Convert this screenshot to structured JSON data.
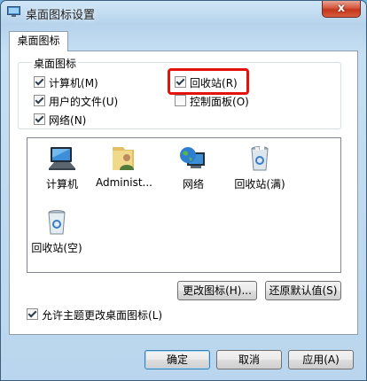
{
  "window": {
    "title": "桌面图标设置",
    "close_glyph": "x"
  },
  "tab": {
    "label": "桌面图标"
  },
  "group": {
    "title": "桌面图标",
    "items": [
      {
        "label": "计算机",
        "key": "(M)",
        "checked": true
      },
      {
        "label": "回收站",
        "key": "(R)",
        "checked": true,
        "highlighted": true
      },
      {
        "label": "用户的文件",
        "key": "(U)",
        "checked": true
      },
      {
        "label": "控制面板",
        "key": "(O)",
        "checked": false
      },
      {
        "label": "网络",
        "key": "(N)",
        "checked": true
      }
    ]
  },
  "icons": [
    {
      "name": "computer-icon",
      "caption": "计算机"
    },
    {
      "name": "user-folder-icon",
      "caption": "Administ..."
    },
    {
      "name": "network-globe-icon",
      "caption": "网络"
    },
    {
      "name": "recycle-bin-full-icon",
      "caption": "回收站(满)"
    },
    {
      "name": "recycle-bin-empty-icon",
      "caption": "回收站(空)"
    }
  ],
  "actions": {
    "change_icon": "更改图标(H)...",
    "restore_default": "还原默认值(S)"
  },
  "theme_option": {
    "label": "允许主题更改桌面图标",
    "key": "(L)",
    "checked": true
  },
  "footer": {
    "ok": "确定",
    "cancel": "取消",
    "apply": "应用",
    "apply_key": "(A)"
  },
  "colors": {
    "highlight": "#e3120b",
    "close_button": "#c4361b"
  }
}
